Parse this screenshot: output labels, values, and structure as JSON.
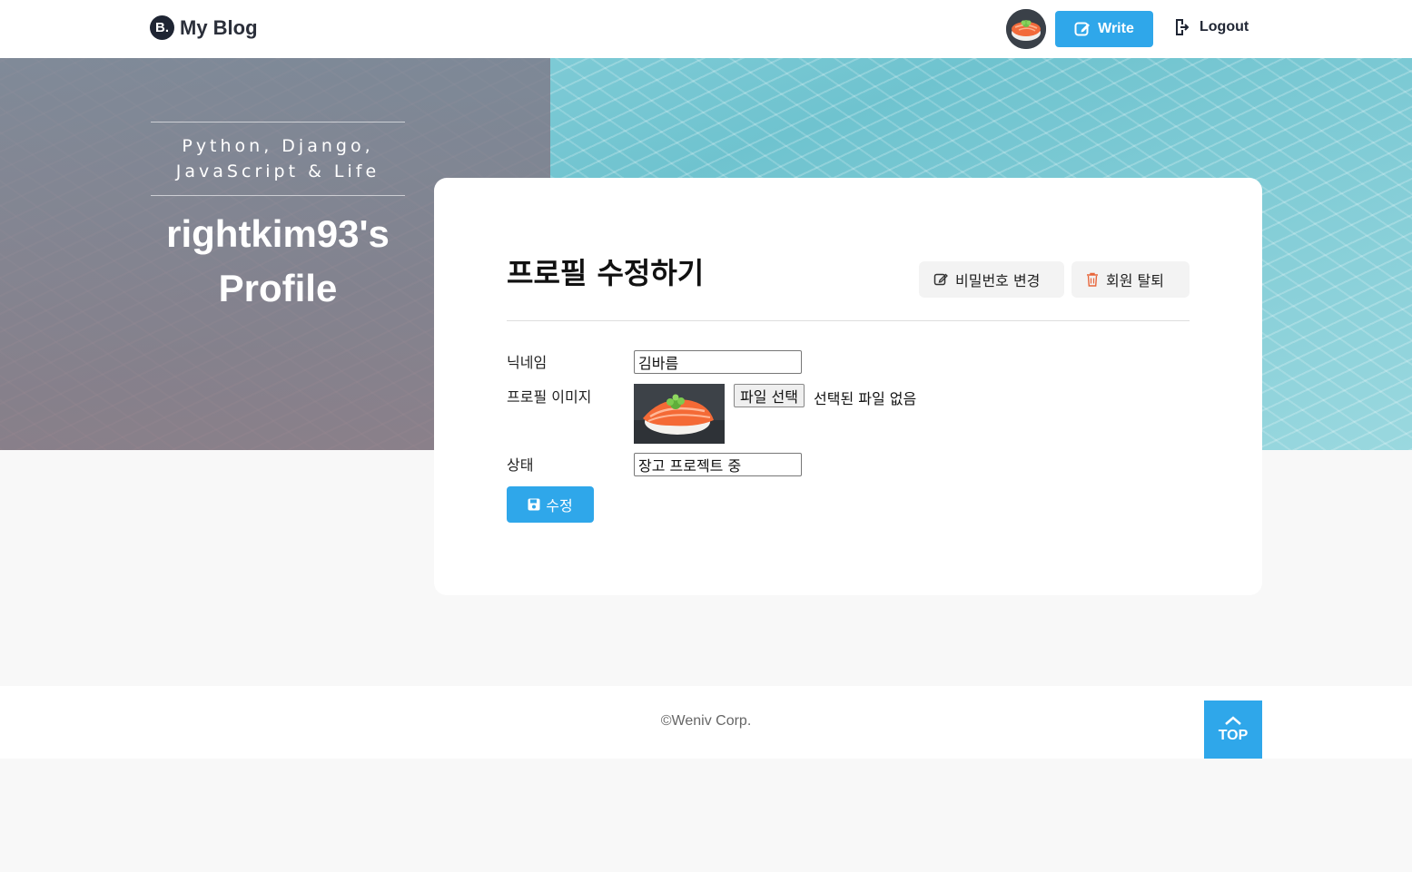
{
  "header": {
    "logo_mark": "B.",
    "logo_text": "My Blog",
    "write_label": "Write",
    "logout_label": "Logout"
  },
  "hero": {
    "tagline_line1": "Python, Django,",
    "tagline_line2": "JavaScript & Life",
    "title_line1": "rightkim93's",
    "title_line2": "Profile"
  },
  "form": {
    "title": "프로필 수정하기",
    "change_password_label": "비밀번호 변경",
    "delete_account_label": "회원 탈퇴",
    "nickname_label": "닉네임",
    "nickname_value": "김바름",
    "image_label": "프로필 이미지",
    "file_button_label": "파일 선택",
    "file_status": "선택된 파일 없음",
    "status_label": "상태",
    "status_value": "장고 프로젝트 중",
    "submit_label": "수정"
  },
  "footer": {
    "copyright": "©Weniv Corp.",
    "top_label": "TOP"
  },
  "colors": {
    "accent": "#2fa7ea",
    "dark": "#1f2533",
    "delete_icon": "#e8663b"
  },
  "icons": {
    "write": "edit-icon",
    "logout": "logout-icon",
    "password": "edit-icon",
    "delete": "trash-icon",
    "submit": "save-icon",
    "top": "chevron-up-icon"
  }
}
